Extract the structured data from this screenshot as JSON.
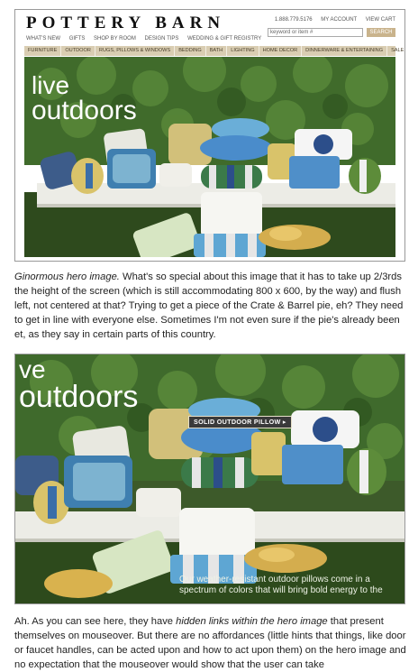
{
  "shot1": {
    "logo": "POTTERY BARN",
    "util": {
      "phone": "1.888.779.5176",
      "account": "MY ACCOUNT",
      "cart": "VIEW CART"
    },
    "search": {
      "placeholder": "keyword or item #",
      "button": "SEARCH"
    },
    "topnav": [
      "WHAT'S NEW",
      "GIFTS",
      "SHOP BY ROOM",
      "DESIGN TIPS",
      "WEDDING & GIFT REGISTRY"
    ],
    "categories": [
      "FURNITURE",
      "OUTDOOR",
      "RUGS, PILLOWS & WINDOWS",
      "BEDDING",
      "BATH",
      "LIGHTING",
      "HOME DECOR",
      "DINNERWARE & ENTERTAINING",
      "SALE"
    ],
    "hero_word1": "live",
    "hero_word2": "outdoors"
  },
  "caption1": {
    "emph": "Ginormous hero image.",
    "text": " What's so special about this image that it has to take up 2/3rds the height of the screen (which is still accommodating 800 x 600, by the way) and flush left, not centered at that? Trying to get a piece of the Crate & Barrel pie, eh? They need to get in line with everyone else. Sometimes I'm not even sure if the pie's already been et, as they say in certain parts of this country."
  },
  "shot2": {
    "hero_word1": "ve",
    "hero_word2": "outdoors",
    "hover_tag": "SOLID OUTDOOR PILLOW ▸",
    "copy": "Our weather-resistant outdoor pillows come in a spectrum of colors that will bring bold energy to the"
  },
  "caption2": {
    "pre": "Ah. As you can see here, they have ",
    "emph": "hidden links within the hero image",
    "post": " that present themselves on mouseover. But there are no affordances (little hints that things, like door or faucet handles, can be acted upon and how to act upon them) on the hero image and no expectation that the mouseover would show that the user can take"
  },
  "colors": {
    "catbar": "#d9cdb2",
    "foliage": "#3f6a2c",
    "bench": "#ecece6",
    "grass": "#2f4a1e",
    "pillow_blue": "#4f8fc9",
    "pillow_yellow": "#d9c36a",
    "pillow_green": "#5d8c3a"
  }
}
